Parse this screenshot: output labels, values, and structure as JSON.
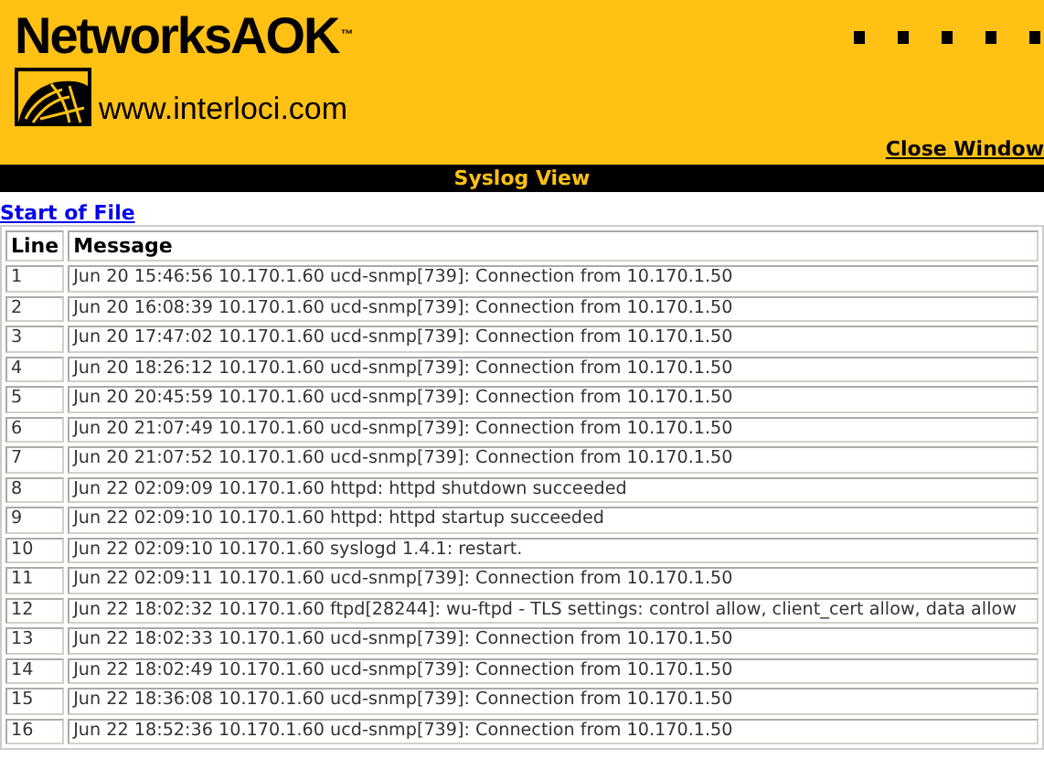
{
  "header": {
    "brand": "NetworksAOK",
    "trademark": "™",
    "website": "www.interloci.com",
    "close_link": "Close Window"
  },
  "title_bar": "Syslog View",
  "start_link": "Start of File",
  "table": {
    "columns": [
      "Line",
      "Message"
    ],
    "rows": [
      {
        "line": "1",
        "message": "Jun 20 15:46:56 10.170.1.60 ucd-snmp[739]: Connection from 10.170.1.50"
      },
      {
        "line": "2",
        "message": "Jun 20 16:08:39 10.170.1.60 ucd-snmp[739]: Connection from 10.170.1.50"
      },
      {
        "line": "3",
        "message": "Jun 20 17:47:02 10.170.1.60 ucd-snmp[739]: Connection from 10.170.1.50"
      },
      {
        "line": "4",
        "message": "Jun 20 18:26:12 10.170.1.60 ucd-snmp[739]: Connection from 10.170.1.50"
      },
      {
        "line": "5",
        "message": "Jun 20 20:45:59 10.170.1.60 ucd-snmp[739]: Connection from 10.170.1.50"
      },
      {
        "line": "6",
        "message": "Jun 20 21:07:49 10.170.1.60 ucd-snmp[739]: Connection from 10.170.1.50"
      },
      {
        "line": "7",
        "message": "Jun 20 21:07:52 10.170.1.60 ucd-snmp[739]: Connection from 10.170.1.50"
      },
      {
        "line": "8",
        "message": "Jun 22 02:09:09 10.170.1.60 httpd: httpd shutdown succeeded"
      },
      {
        "line": "9",
        "message": "Jun 22 02:09:10 10.170.1.60 httpd: httpd startup succeeded"
      },
      {
        "line": "10",
        "message": "Jun 22 02:09:10 10.170.1.60 syslogd 1.4.1: restart."
      },
      {
        "line": "11",
        "message": "Jun 22 02:09:11 10.170.1.60 ucd-snmp[739]: Connection from 10.170.1.50"
      },
      {
        "line": "12",
        "message": "Jun 22 18:02:32 10.170.1.60 ftpd[28244]: wu-ftpd - TLS settings: control allow, client_cert allow, data allow"
      },
      {
        "line": "13",
        "message": "Jun 22 18:02:33 10.170.1.60 ucd-snmp[739]: Connection from 10.170.1.50"
      },
      {
        "line": "14",
        "message": "Jun 22 18:02:49 10.170.1.60 ucd-snmp[739]: Connection from 10.170.1.50"
      },
      {
        "line": "15",
        "message": "Jun 22 18:36:08 10.170.1.60 ucd-snmp[739]: Connection from 10.170.1.50"
      },
      {
        "line": "16",
        "message": "Jun 22 18:52:36 10.170.1.60 ucd-snmp[739]: Connection from 10.170.1.50"
      }
    ]
  }
}
